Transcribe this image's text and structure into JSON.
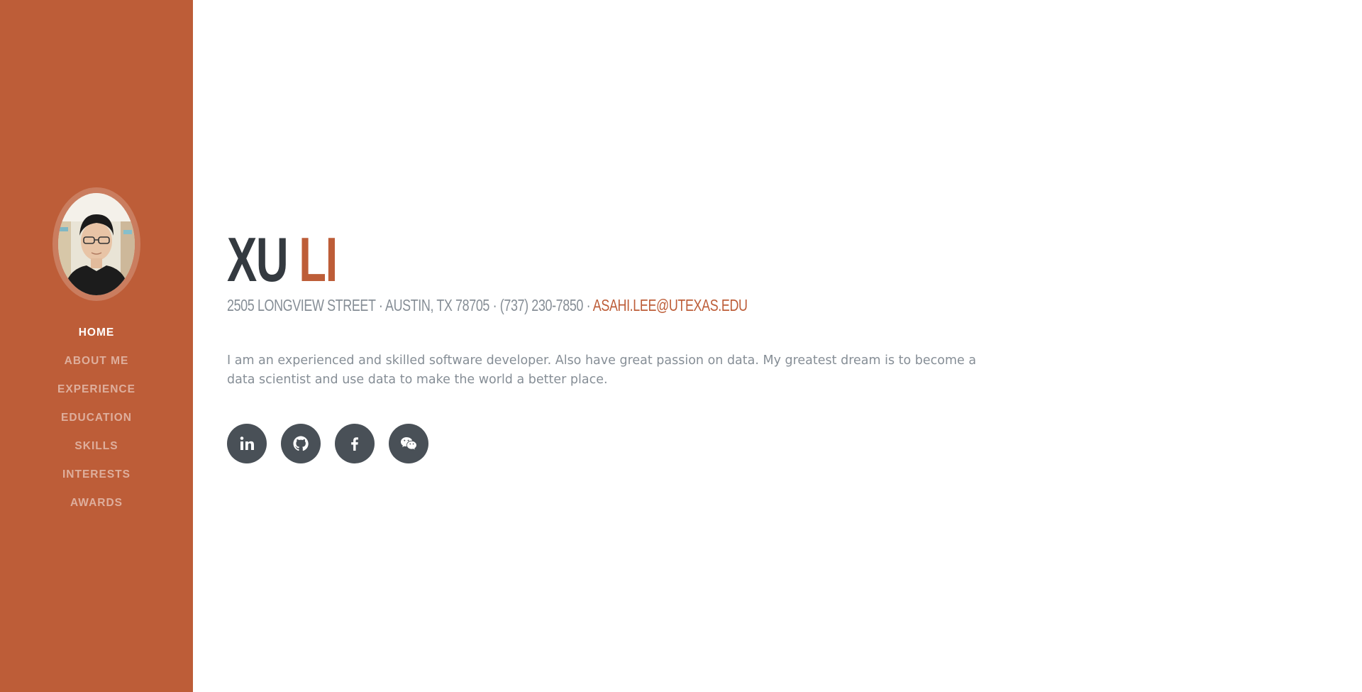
{
  "sidebar": {
    "nav": [
      {
        "label": "Home",
        "active": true
      },
      {
        "label": "About Me"
      },
      {
        "label": "Experience"
      },
      {
        "label": "Education"
      },
      {
        "label": "Skills"
      },
      {
        "label": "Interests"
      },
      {
        "label": "Awards"
      }
    ],
    "avatar_alt": "profile photo"
  },
  "header": {
    "first_name": "Xu",
    "last_name": "Li"
  },
  "contact": {
    "street": "2505 Longview Street",
    "city": "Austin, TX 78705",
    "phone": "(737) 230-7850",
    "separator": " · ",
    "email": "asahi.lee@utexas.edu"
  },
  "about": {
    "text": "I am an experienced and skilled software developer. Also have great passion on data. My greatest dream is to become a data scientist and use data to make the world a better place."
  },
  "social": [
    {
      "icon": "linkedin-icon"
    },
    {
      "icon": "github-icon"
    },
    {
      "icon": "facebook-icon"
    },
    {
      "icon": "wechat-icon"
    }
  ],
  "colors": {
    "accent": "#bd5d38",
    "dark": "#343a40",
    "muted": "#868e96",
    "social_bg": "#495057"
  }
}
